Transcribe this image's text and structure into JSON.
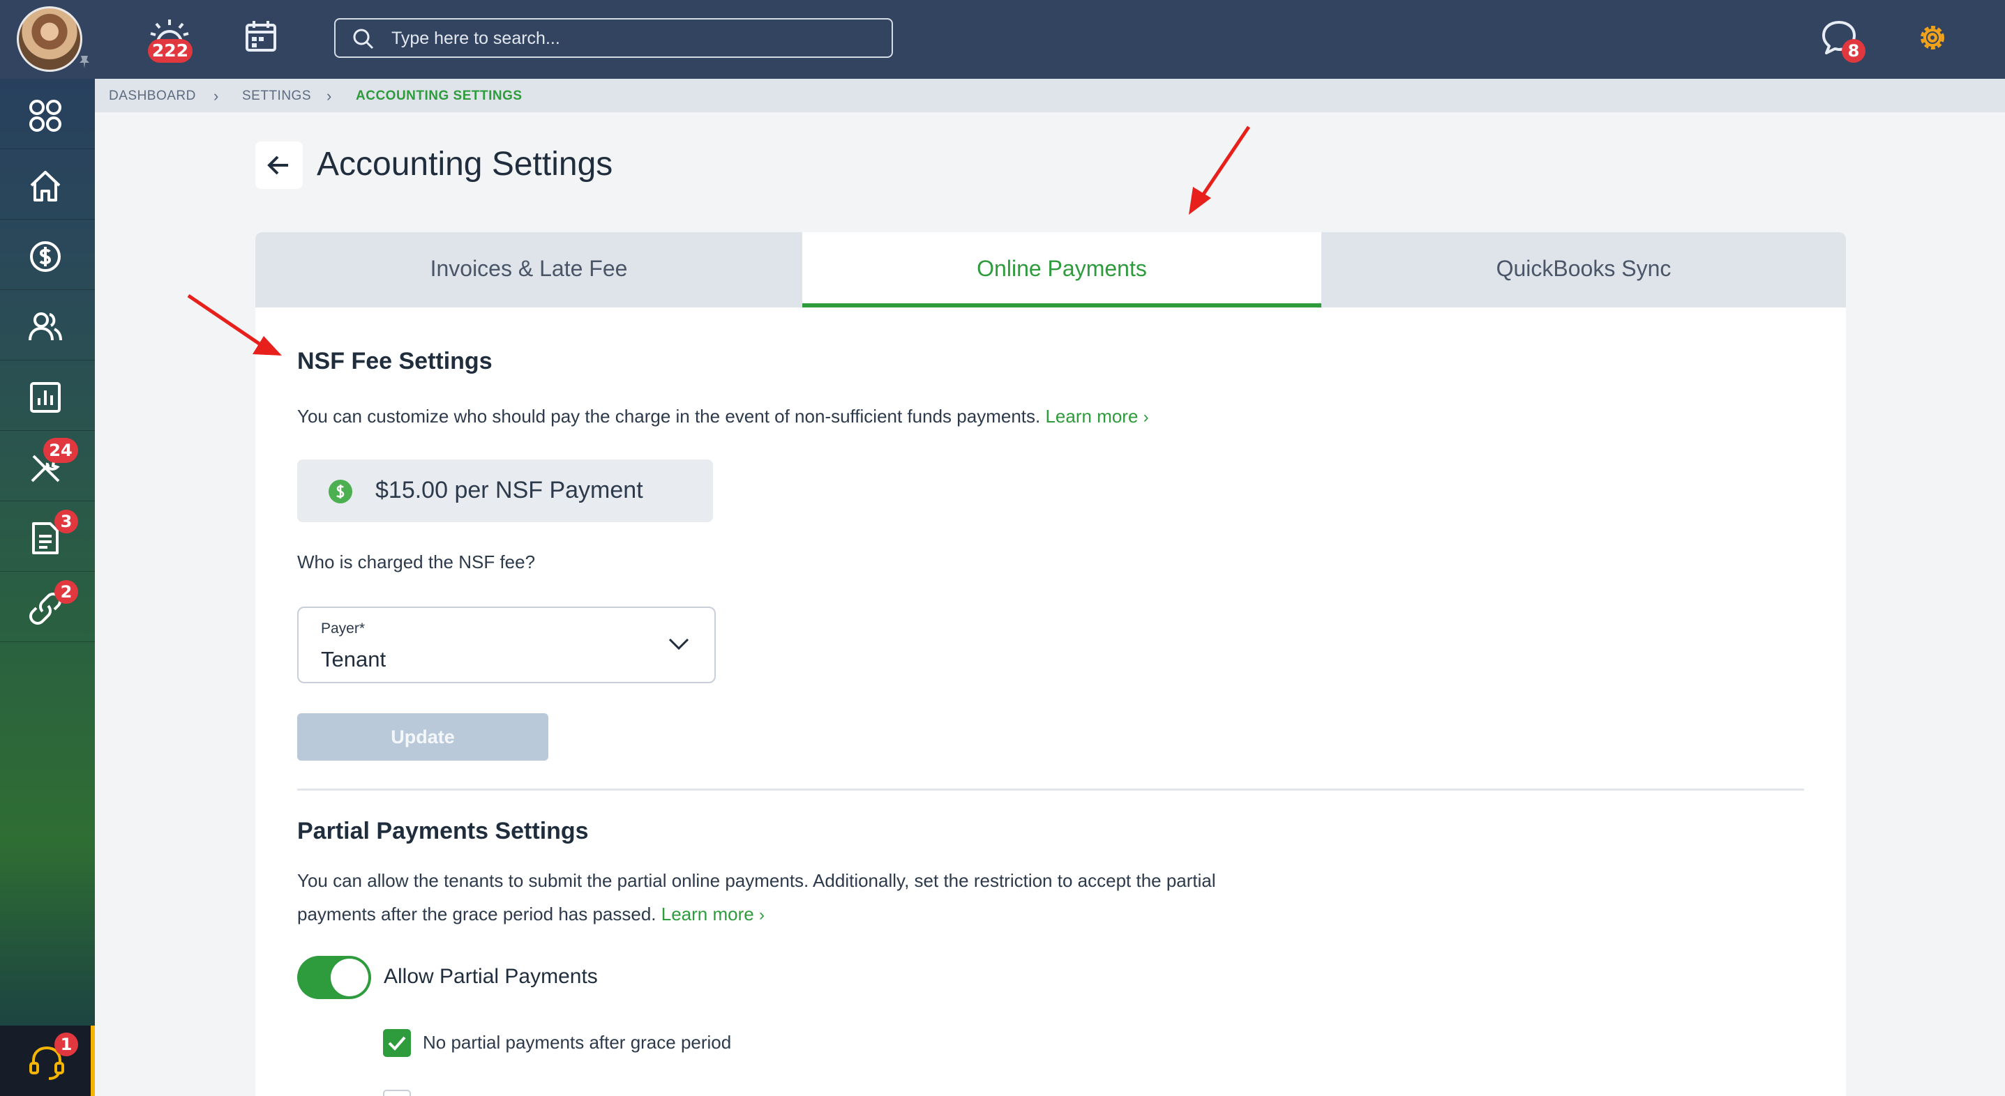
{
  "topbar": {
    "search_placeholder": "Type here to search...",
    "notifications_badge": "222",
    "messages_badge": "8"
  },
  "sidebar": {
    "items": [
      {
        "name": "apps",
        "icon": "grid-icon",
        "badge": ""
      },
      {
        "name": "home",
        "icon": "home-icon",
        "badge": ""
      },
      {
        "name": "accounting",
        "icon": "dollar-icon",
        "badge": ""
      },
      {
        "name": "people",
        "icon": "people-icon",
        "badge": ""
      },
      {
        "name": "reports",
        "icon": "chart-icon",
        "badge": ""
      },
      {
        "name": "maintenance",
        "icon": "tools-icon",
        "badge": "24"
      },
      {
        "name": "documents",
        "icon": "document-icon",
        "badge": "3"
      },
      {
        "name": "links",
        "icon": "link-icon",
        "badge": "2"
      }
    ],
    "support_badge": "1"
  },
  "breadcrumb": {
    "items": [
      "DASHBOARD",
      "SETTINGS",
      "ACCOUNTING SETTINGS"
    ]
  },
  "page": {
    "title": "Accounting Settings"
  },
  "tabs": [
    {
      "label": "Invoices & Late Fee",
      "active": false
    },
    {
      "label": "Online Payments",
      "active": true
    },
    {
      "label": "QuickBooks Sync",
      "active": false
    }
  ],
  "nsf": {
    "heading": "NSF Fee Settings",
    "description": "You can customize who should pay the charge in the event of non-sufficient funds payments.",
    "learn_more": "Learn more",
    "fee_text": "$15.00 per NSF Payment",
    "question": "Who is charged the NSF fee?",
    "payer_label": "Payer*",
    "payer_value": "Tenant",
    "update_label": "Update"
  },
  "partial": {
    "heading": "Partial Payments Settings",
    "description_line1": "You can allow the tenants to submit the partial online payments. Additionally, set the restriction to accept the partial",
    "description_line2": "payments after the grace period has passed.",
    "learn_more": "Learn more",
    "toggle_label": "Allow Partial Payments",
    "toggle_on": true,
    "checkbox_label": "No partial payments after grace period",
    "checkbox_checked": true
  },
  "colors": {
    "accent": "#2e9b3d",
    "topbar": "#334460",
    "badge": "#e0383e",
    "annotation_arrow": "#e8201c"
  }
}
